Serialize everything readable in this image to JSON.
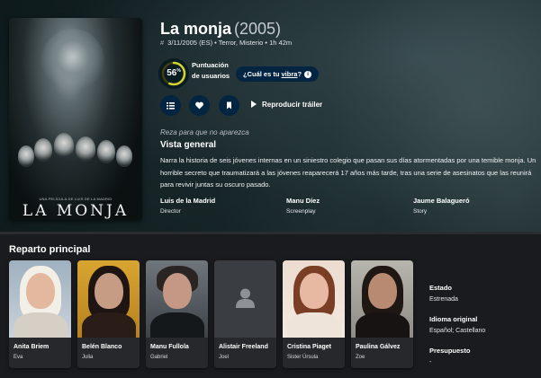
{
  "movie": {
    "title": "La monja",
    "year": "(2005)",
    "certification": "#",
    "facts": "3/11/2005 (ES) • Terror, Misterio • 1h 42m",
    "score": "56",
    "score_unit": "%",
    "score_fraction": 0.56,
    "score_label": "Puntuación de usuarios",
    "vibe_prefix": "¿Cuál es tu ",
    "vibe_link": "vibra",
    "vibe_suffix": "?",
    "trailer_label": "Reproducir tráiler",
    "tagline": "Reza para que no aparezca",
    "overview_heading": "Vista general",
    "overview": "Narra la historia de seis jóvenes internas en un siniestro colegio que pasan sus días atormentadas por una temible monja. Un horrible secreto que traumatizará a las jóvenes reaparecerá 17 años más tarde, tras una serie de asesinatos que las reunirá para revivir juntas su oscuro pasado."
  },
  "poster": {
    "tagline": "UNA PELÍCULA DE LUIS DE LA MADRID",
    "title": "LA MONJA"
  },
  "crew": [
    {
      "name": "Luis de la Madrid",
      "job": "Director"
    },
    {
      "name": "Manu Díez",
      "job": "Screenplay"
    },
    {
      "name": "Jaume Balagueró",
      "job": "Story"
    }
  ],
  "cast_heading": "Reparto principal",
  "cast": [
    {
      "name": "Anita Briem",
      "role": "Eva"
    },
    {
      "name": "Belén Blanco",
      "role": "Julia"
    },
    {
      "name": "Manu Fullola",
      "role": "Gabriel"
    },
    {
      "name": "Alistair Freeland",
      "role": "Joel"
    },
    {
      "name": "Cristina Piaget",
      "role": "Sister Úrsula"
    },
    {
      "name": "Paulina Gálvez",
      "role": "Zoe"
    }
  ],
  "side_facts": [
    {
      "label": "Estado",
      "value": "Estrenada"
    },
    {
      "label": "Idioma original",
      "value": "Español; Castellano"
    },
    {
      "label": "Presupuesto",
      "value": "-"
    }
  ],
  "colors": {
    "score_ring": "#d2d531",
    "score_track": "#423d0f",
    "button_bg": "#032541"
  }
}
